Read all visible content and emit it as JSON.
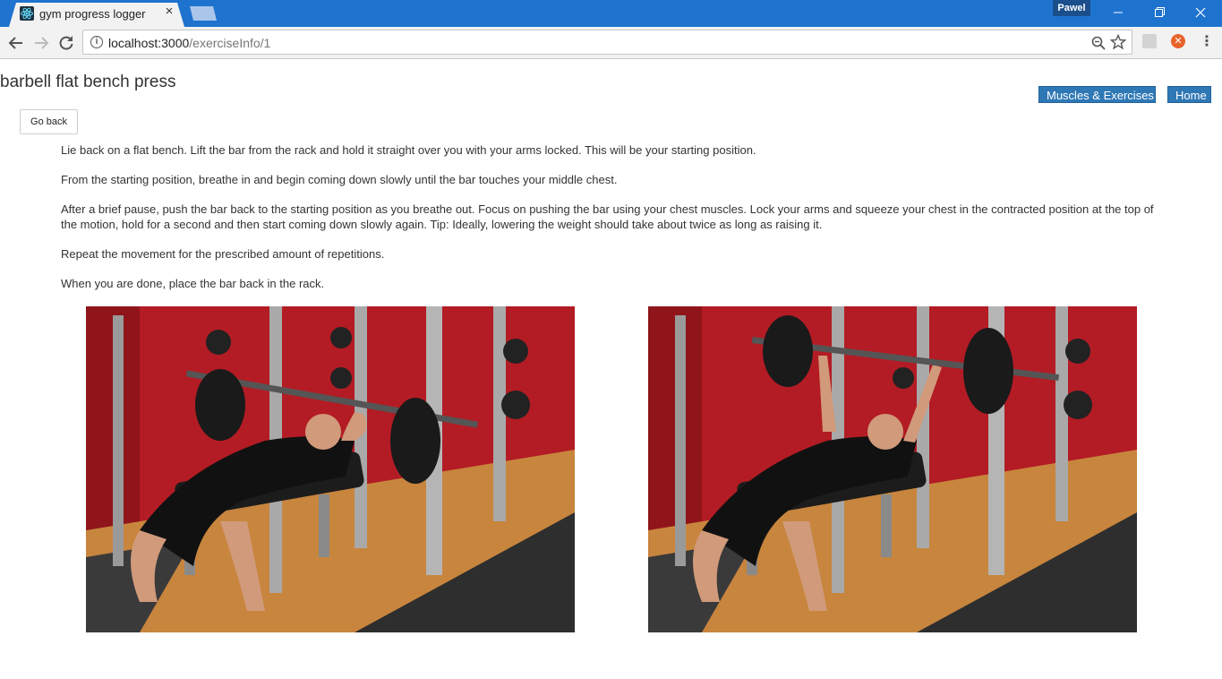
{
  "browser": {
    "tab_title": "gym progress logger",
    "profile_name": "Pawel",
    "url_host": "localhost:3000",
    "url_path": "/exerciseInfo/1"
  },
  "page": {
    "title": "barbell flat bench press",
    "nav": {
      "muscles_label": "Muscles & Exercises",
      "home_label": "Home"
    },
    "go_back_label": "Go back",
    "instructions": [
      "Lie back on a flat bench. Lift the bar from the rack and hold it straight over you with your arms locked. This will be your starting position.",
      "From the starting position, breathe in and begin coming down slowly until the bar touches your middle chest.",
      "After a brief pause, push the bar back to the starting position as you breathe out. Focus on pushing the bar using your chest muscles. Lock your arms and squeeze your chest in the contracted position at the top of the motion, hold for a second and then start coming down slowly again. Tip: Ideally, lowering the weight should take about twice as long as raising it.",
      "Repeat the movement for the prescribed amount of repetitions.",
      "When you are done, place the bar back in the rack."
    ]
  },
  "icons": {
    "favicon": "react-atom-icon",
    "back": "arrow-left-icon",
    "forward": "arrow-right-icon",
    "reload": "reload-icon",
    "info": "info-icon",
    "zoom": "zoom-icon",
    "bookmark": "star-icon",
    "menu": "kebab-menu-icon"
  },
  "colors": {
    "titlebar": "#1e73cf",
    "nav_button": "#2f78b6",
    "wall_red": "#b31c24",
    "floor_wood": "#c8853e"
  }
}
